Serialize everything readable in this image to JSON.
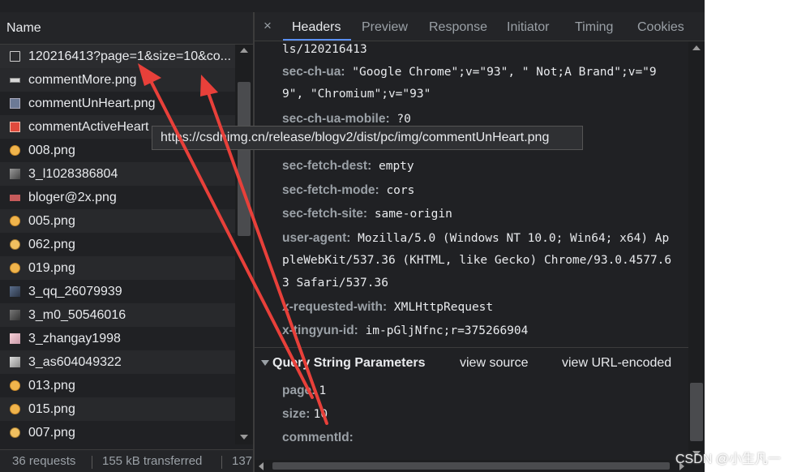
{
  "name_column": {
    "label": "Name"
  },
  "requests": [
    {
      "name": "120216413?page=1&size=10&co...",
      "icon": "document-icon"
    },
    {
      "name": "commentMore.png",
      "icon": "image-icon"
    },
    {
      "name": "commentUnHeart.png",
      "icon": "image-icon"
    },
    {
      "name": "commentActiveHeart",
      "icon": "image-icon"
    },
    {
      "name": "008.png",
      "icon": "emoji-image-icon"
    },
    {
      "name": "3_l1028386804",
      "icon": "avatar-image-icon"
    },
    {
      "name": "bloger@2x.png",
      "icon": "image-icon"
    },
    {
      "name": "005.png",
      "icon": "emoji-image-icon"
    },
    {
      "name": "062.png",
      "icon": "emoji-image-icon"
    },
    {
      "name": "019.png",
      "icon": "emoji-image-icon"
    },
    {
      "name": "3_qq_26079939",
      "icon": "avatar-image-icon"
    },
    {
      "name": "3_m0_50546016",
      "icon": "avatar-image-icon"
    },
    {
      "name": "3_zhangay1998",
      "icon": "avatar-image-icon"
    },
    {
      "name": "3_as604049322",
      "icon": "avatar-image-icon"
    },
    {
      "name": "013.png",
      "icon": "emoji-image-icon"
    },
    {
      "name": "015.png",
      "icon": "emoji-image-icon"
    },
    {
      "name": "007.png",
      "icon": "emoji-image-icon"
    }
  ],
  "status": {
    "requests": "36 requests",
    "transferred": "155 kB transferred",
    "more": "137"
  },
  "tabs": {
    "close": "×",
    "headers": "Headers",
    "preview": "Preview",
    "response": "Response",
    "initiator": "Initiator",
    "timing": "Timing",
    "cookies": "Cookies"
  },
  "headers": {
    "partial_line": "ls/120216413",
    "sec_ch_ua": {
      "key": "sec-ch-ua:",
      "value_1": "\"Google Chrome\";v=\"93\", \" Not;A Brand\";v=\"9",
      "value_2": "9\", \"Chromium\";v=\"93\""
    },
    "sec_ch_ua_mobile": {
      "key": "sec-ch-ua-mobile:",
      "value": "?0"
    },
    "sec_fetch_dest": {
      "key": "sec-fetch-dest:",
      "value": "empty"
    },
    "sec_fetch_mode": {
      "key": "sec-fetch-mode:",
      "value": "cors"
    },
    "sec_fetch_site": {
      "key": "sec-fetch-site:",
      "value": "same-origin"
    },
    "user_agent": {
      "key": "user-agent:",
      "value_1": "Mozilla/5.0 (Windows NT 10.0; Win64; x64) Ap",
      "value_2": "pleWebKit/537.36 (KHTML, like Gecko) Chrome/93.0.4577.6",
      "value_3": "3 Safari/537.36"
    },
    "x_requested_with": {
      "key": "x-requested-with:",
      "value": "XMLHttpRequest"
    },
    "x_tingyun_id": {
      "key": "x-tingyun-id:",
      "value": "im-pGljNfnc;r=375266904"
    }
  },
  "query_string": {
    "title": "Query String Parameters",
    "view_source": "view source",
    "view_url_encoded": "view URL-encoded",
    "page": {
      "key": "page:",
      "value": "1"
    },
    "size": {
      "key": "size:",
      "value": "10"
    },
    "comment_id": {
      "key": "commentId:",
      "value": ""
    }
  },
  "tooltip": "https://csdnimg.cn/release/blogv2/dist/pc/img/commentUnHeart.png",
  "watermark": "CSDN @小生凡一",
  "colors": {
    "annotation_arrow": "#e8403a",
    "tab_underline": "#5a8ff0",
    "panel_bg": "#202124"
  }
}
